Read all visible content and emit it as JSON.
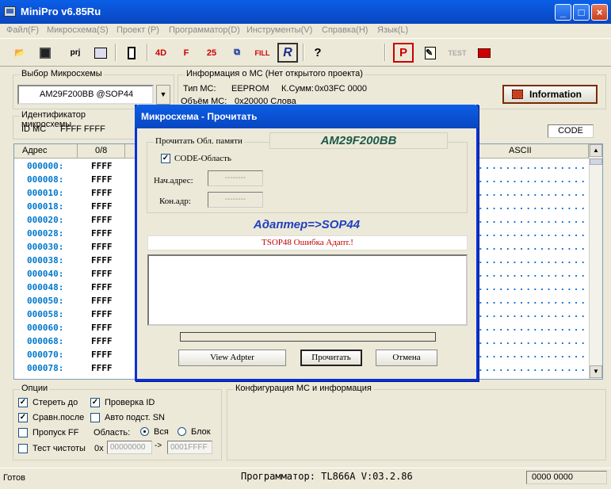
{
  "window": {
    "title": "MiniPro v6.85Ru"
  },
  "menu": [
    "Файл(F)",
    "Микросхема(S)",
    "Проект (P)",
    "Программатор(D)",
    "Инструменты(V)",
    "Справка(H)",
    "Язык(L)"
  ],
  "toolbar": {
    "prj_label": "prj",
    "fill_label": "FILL",
    "test_label": "TEST",
    "help_glyph": "?",
    "r_glyph": "R",
    "p_glyph": "P"
  },
  "chip_select": {
    "label": "Выбор Микросхемы",
    "value": "AM29F200BB  @SOP44"
  },
  "ic_info": {
    "label": "Информация о МС (Нет открытого проекта)",
    "type_label": "Тип МС:",
    "type_value": "EEPROM",
    "checksum_label": "К.Сумм:",
    "checksum_value": "0x03FC 0000",
    "size_label": "Объём МС:",
    "size_value": "0x20000 Слова"
  },
  "information_button": "Information",
  "identifier": {
    "label": "Идентификатор микросхемы",
    "id_label": "ID МС",
    "id_value": "FFFF FFFF"
  },
  "code_box": "CODE",
  "grid": {
    "col_addr": "Адрес",
    "col_first": "0/8",
    "col_ascii": "ASCII",
    "rows": [
      {
        "addr": "000000:",
        "val": "FFFF"
      },
      {
        "addr": "000008:",
        "val": "FFFF"
      },
      {
        "addr": "000010:",
        "val": "FFFF"
      },
      {
        "addr": "000018:",
        "val": "FFFF"
      },
      {
        "addr": "000020:",
        "val": "FFFF"
      },
      {
        "addr": "000028:",
        "val": "FFFF"
      },
      {
        "addr": "000030:",
        "val": "FFFF"
      },
      {
        "addr": "000038:",
        "val": "FFFF"
      },
      {
        "addr": "000040:",
        "val": "FFFF"
      },
      {
        "addr": "000048:",
        "val": "FFFF"
      },
      {
        "addr": "000050:",
        "val": "FFFF"
      },
      {
        "addr": "000058:",
        "val": "FFFF"
      },
      {
        "addr": "000060:",
        "val": "FFFF"
      },
      {
        "addr": "000068:",
        "val": "FFFF"
      },
      {
        "addr": "000070:",
        "val": "FFFF"
      },
      {
        "addr": "000078:",
        "val": "FFFF"
      }
    ],
    "ascii_dots": "................"
  },
  "options": {
    "label": "Опции",
    "erase": "Стереть до",
    "check_id": "Проверка ID",
    "compare_after": "Сравн.после",
    "auto_sn": "Авто подст. SN",
    "skip_ff": "Пропуск FF",
    "area_label": "Область:",
    "area_all": "Вся",
    "area_block": "Блок",
    "blank_test": "Тест чистоты",
    "range_prefix": "0x",
    "range_from": "00000000",
    "range_arrow": "->",
    "range_to": "0001FFFF"
  },
  "config": {
    "label": "Конфигурация МС и информация"
  },
  "status": {
    "left": "Готов",
    "programmer": "Программатор: TL866A V:03.2.86",
    "right": "0000 0000"
  },
  "dialog": {
    "title": "Микросхема - Прочитать",
    "group_label": "Прочитать Обл. памяти",
    "chip_name": "AM29F200BB",
    "code_area": "CODE-Область",
    "start_label": "Нач.адрес:",
    "start_value": "--------",
    "end_label": "Кон.адр:",
    "end_value": "--------",
    "adapter": "Адаптер=>SOP44",
    "error": "TSOP48 Ошибка Адапт.!",
    "btn_view": "View Adpter",
    "btn_read": "Прочитать",
    "btn_cancel": "Отмена"
  }
}
